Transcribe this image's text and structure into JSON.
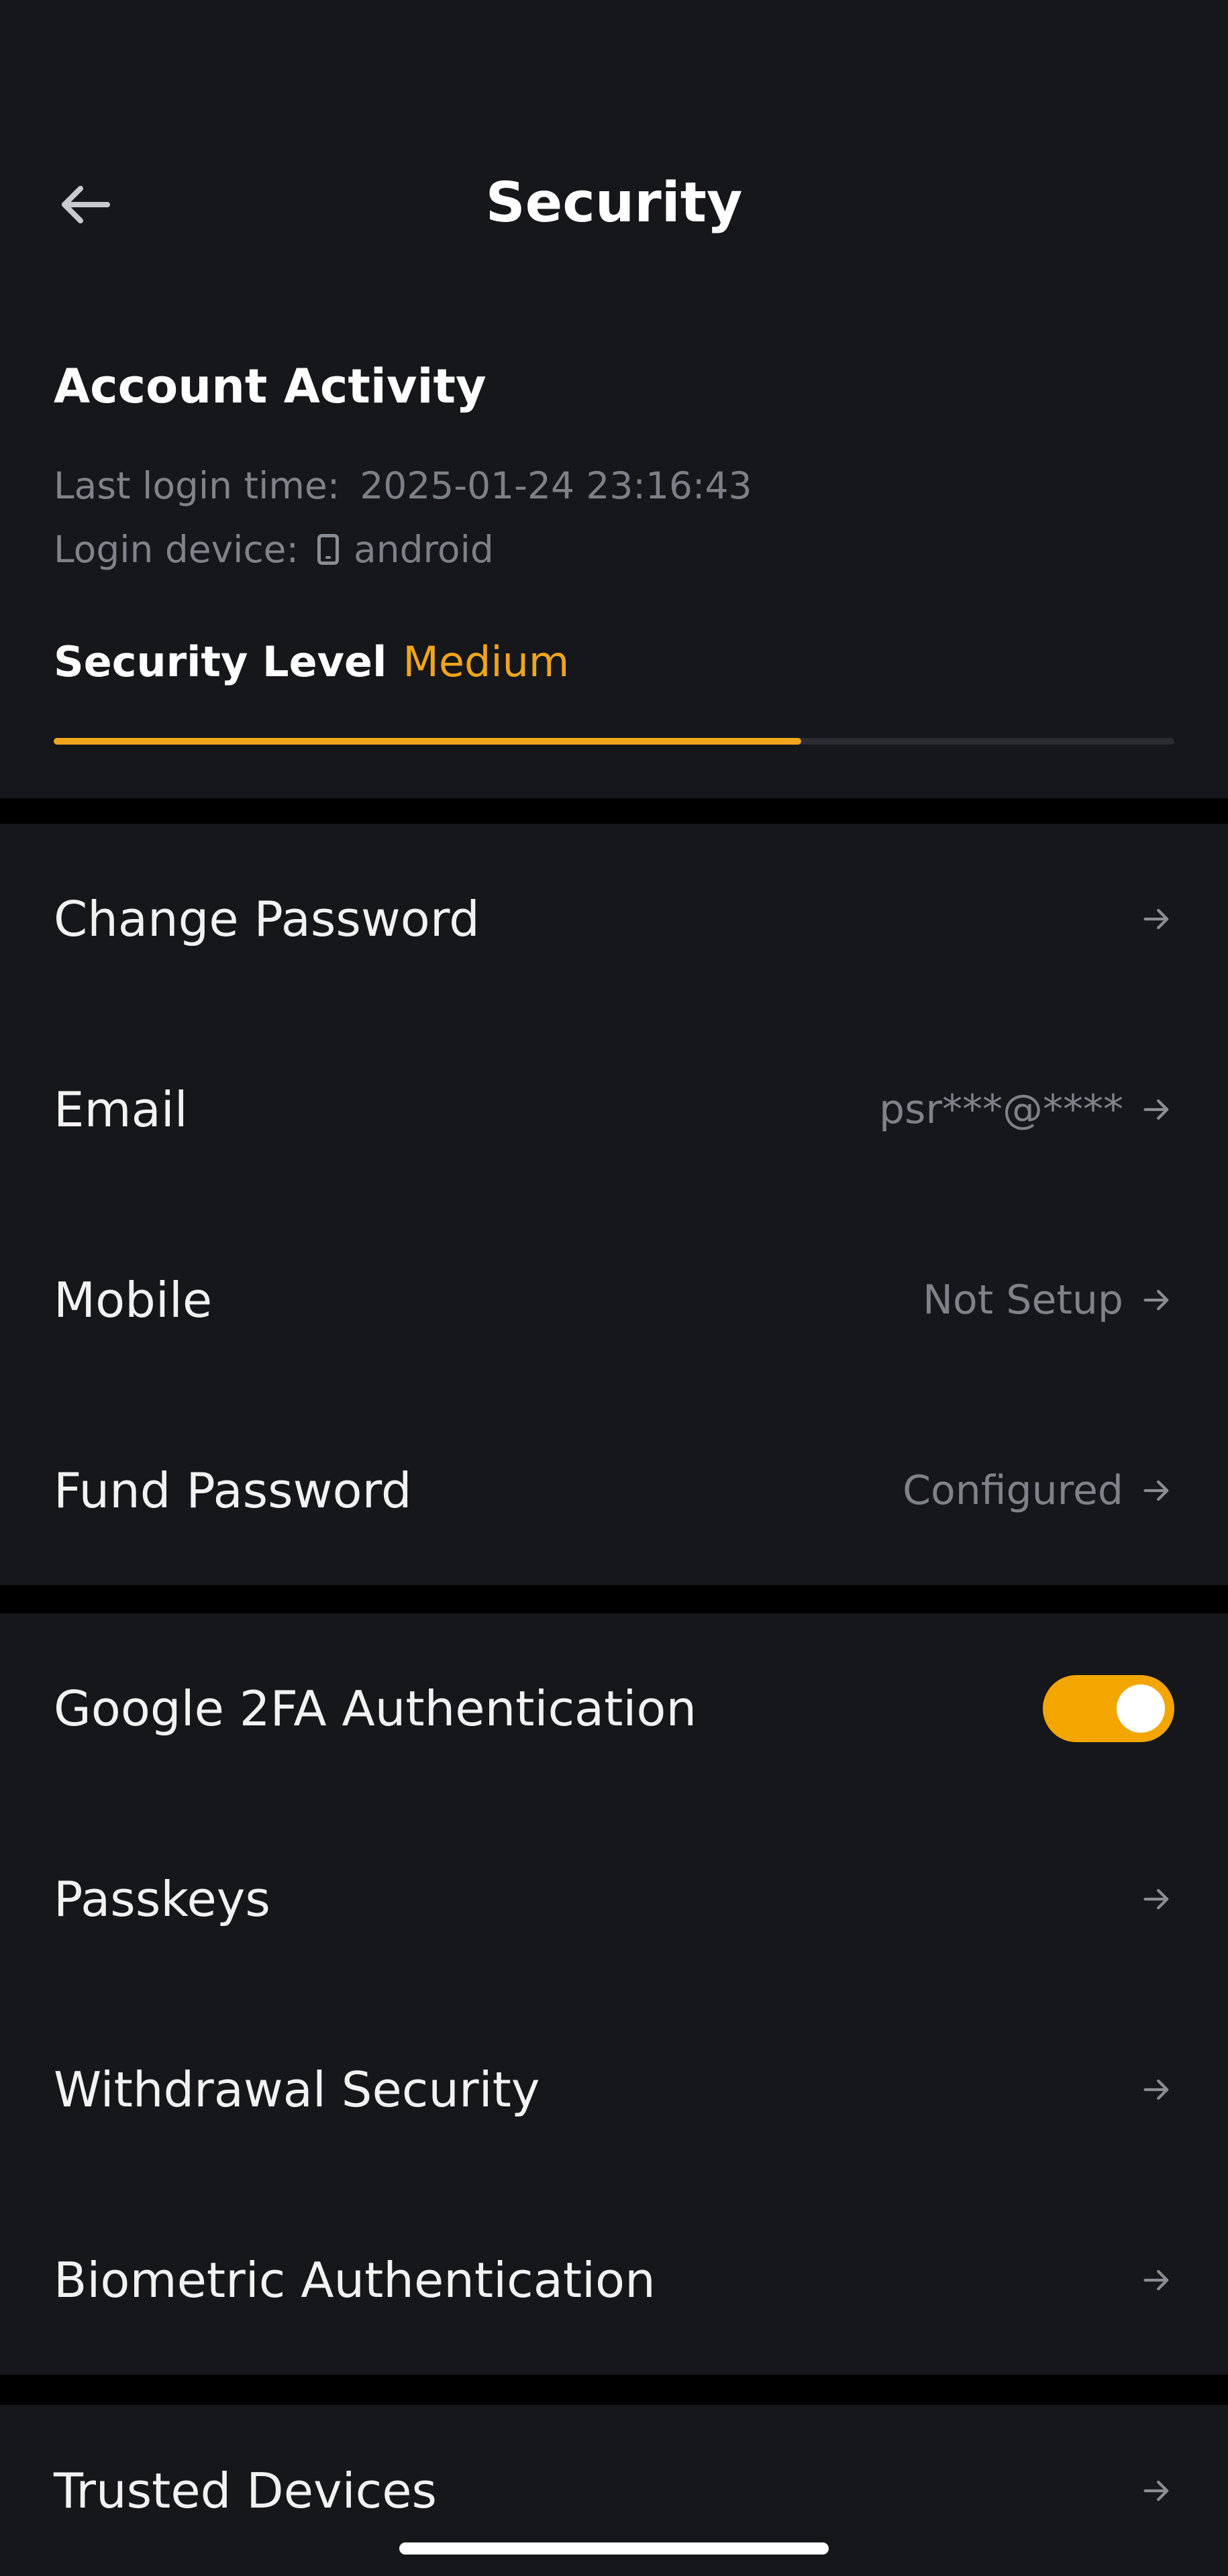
{
  "header": {
    "title": "Security",
    "back_icon": "arrow-left-icon"
  },
  "account_activity": {
    "title": "Account Activity",
    "last_login_label": "Last login time:",
    "last_login_value": "2025-01-24 23:16:43",
    "device_label": "Login device:",
    "device_icon": "phone-icon",
    "device_value": "android",
    "security_level_label": "Security Level",
    "security_level_value": "Medium",
    "security_level_progress": 0.667
  },
  "section_account": {
    "items": [
      {
        "label": "Change Password",
        "value": ""
      },
      {
        "label": "Email",
        "value": "psr***@****"
      },
      {
        "label": "Mobile",
        "value": "Not Setup"
      },
      {
        "label": "Fund Password",
        "value": "Configured"
      }
    ]
  },
  "section_auth": {
    "google_2fa": {
      "label": "Google 2FA Authentication",
      "enabled": true
    },
    "items": [
      {
        "label": "Passkeys",
        "value": ""
      },
      {
        "label": "Withdrawal Security",
        "value": ""
      },
      {
        "label": "Biometric Authentication",
        "value": ""
      }
    ]
  },
  "section_devices": {
    "items": [
      {
        "label": "Trusted Devices",
        "value": ""
      }
    ]
  },
  "colors": {
    "accent": "#f0a51d",
    "toggle_on": "#f3a600",
    "background": "#000000",
    "card": "#16171b"
  }
}
